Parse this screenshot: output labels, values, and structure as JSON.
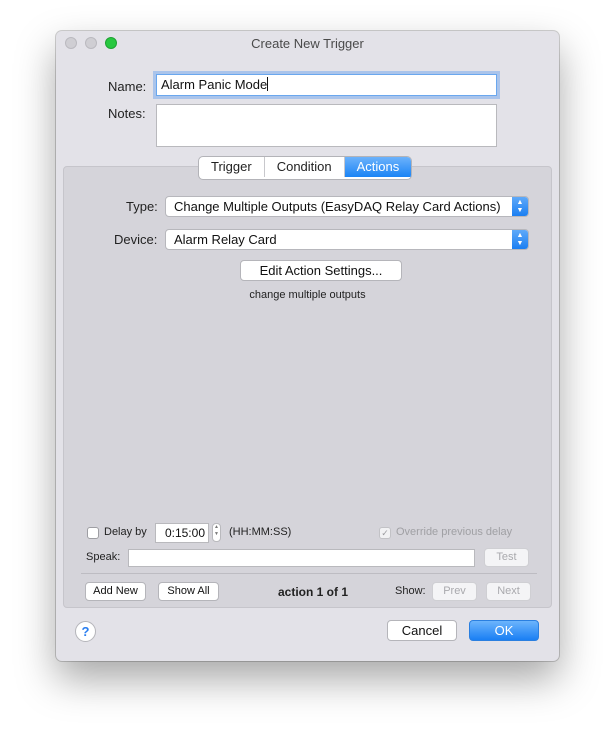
{
  "window": {
    "title": "Create New Trigger"
  },
  "form": {
    "name_label": "Name:",
    "name_value": "Alarm Panic Mode",
    "notes_label": "Notes:",
    "notes_value": ""
  },
  "tabs": [
    {
      "label": "Trigger",
      "active": false
    },
    {
      "label": "Condition",
      "active": false
    },
    {
      "label": "Actions",
      "active": true
    }
  ],
  "action": {
    "type_label": "Type:",
    "type_value": "Change Multiple Outputs (EasyDAQ Relay Card Actions)",
    "device_label": "Device:",
    "device_value": "Alarm Relay Card",
    "edit_button": "Edit Action Settings...",
    "description": "change multiple outputs"
  },
  "delay": {
    "label": "Delay by",
    "checked": false,
    "value": "0:15:00",
    "format": "(HH:MM:SS)",
    "override_label": "Override previous delay",
    "override_checked": true
  },
  "speak": {
    "label": "Speak:",
    "value": "",
    "test_button": "Test"
  },
  "footer": {
    "add_new": "Add New",
    "show_all": "Show All",
    "counter": "action 1 of 1",
    "show_label": "Show:",
    "prev": "Prev",
    "next": "Next"
  },
  "buttons": {
    "help": "?",
    "cancel": "Cancel",
    "ok": "OK"
  },
  "colors": {
    "accent": "#1b84f5",
    "close_light": "#cfced3",
    "zoom_light": "#28c840"
  }
}
